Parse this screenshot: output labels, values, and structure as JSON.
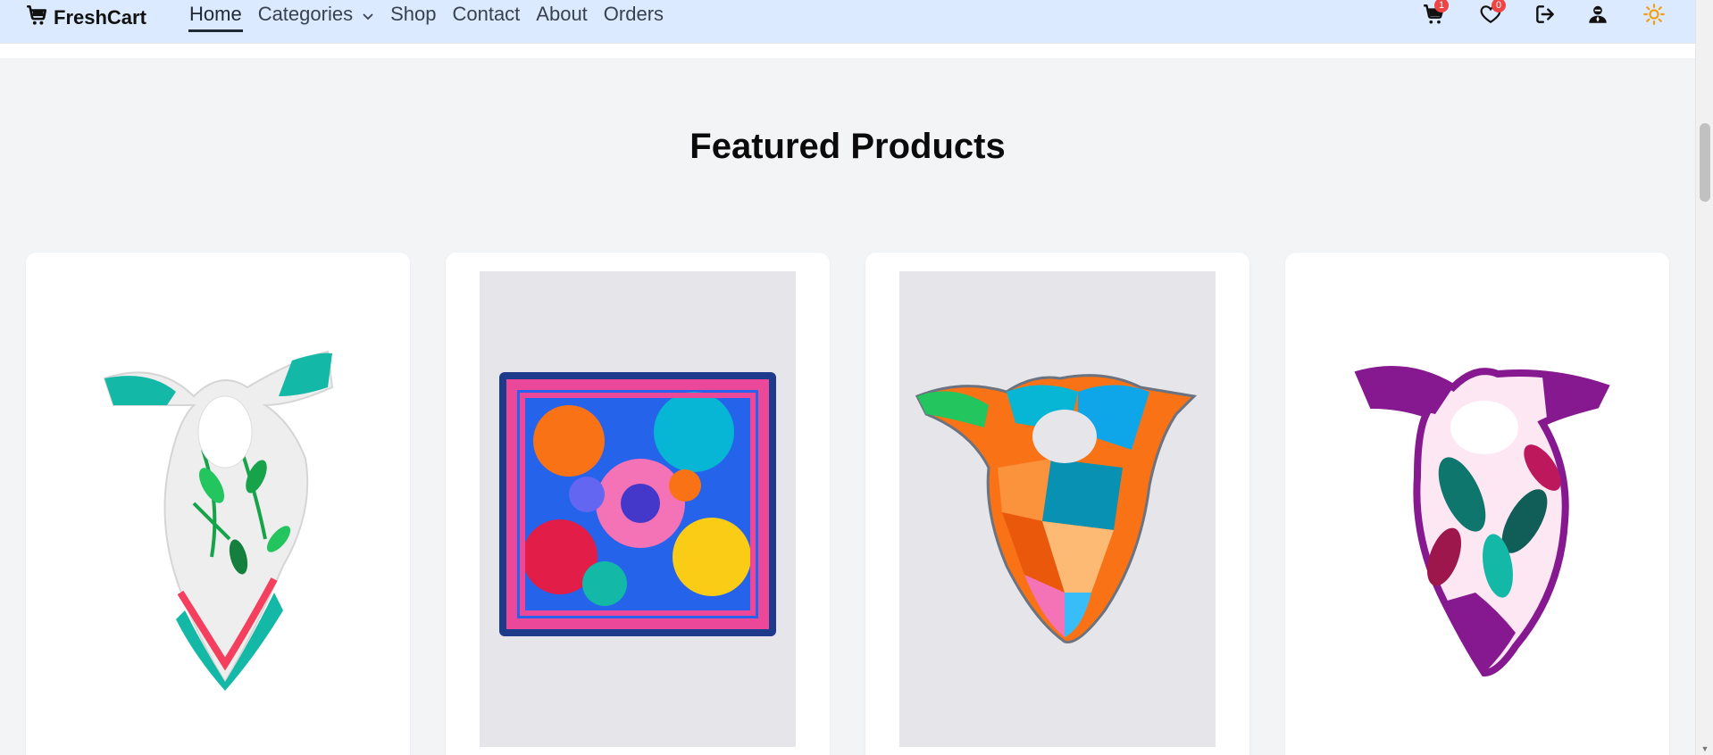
{
  "brand": {
    "name": "FreshCart",
    "icon": "cart-icon"
  },
  "nav": {
    "links": [
      {
        "label": "Home",
        "active": true
      },
      {
        "label": "Categories",
        "dropdown": true
      },
      {
        "label": "Shop"
      },
      {
        "label": "Contact"
      },
      {
        "label": "About"
      },
      {
        "label": "Orders"
      }
    ]
  },
  "header_icons": {
    "cart_count": "1",
    "wishlist_count": "0",
    "icons": [
      "cart-icon",
      "heart-icon",
      "logout-icon",
      "user-icon",
      "sun-icon"
    ]
  },
  "section": {
    "title": "Featured Products"
  },
  "products": [
    {
      "image": "scarf-white-floral-knotted"
    },
    {
      "image": "scarf-colorful-square-flat"
    },
    {
      "image": "scarf-geometric-orange-knotted"
    },
    {
      "image": "scarf-burgundy-floral-knotted"
    }
  ],
  "colors": {
    "navbar_bg": "#dbeafe",
    "page_bg": "#f3f4f6",
    "badge": "#ef4444",
    "sun": "#f59e0b"
  }
}
